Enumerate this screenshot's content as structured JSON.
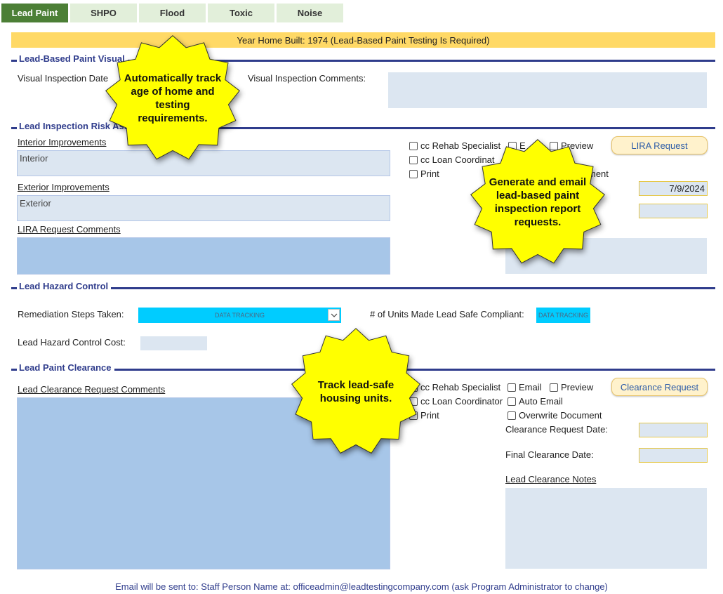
{
  "tabs": [
    {
      "label": "Lead Paint",
      "active": true
    },
    {
      "label": "SHPO",
      "active": false
    },
    {
      "label": "Flood",
      "active": false
    },
    {
      "label": "Toxic",
      "active": false
    },
    {
      "label": "Noise",
      "active": false
    }
  ],
  "banner": "Year Home Built: 1974 (Lead-Based Paint Testing Is Required)",
  "sections": {
    "visual": {
      "title": "Lead-Based Paint Visual",
      "date_label": "Visual Inspection Date",
      "comments_label": "Visual Inspection Comments:"
    },
    "lira": {
      "title": "Lead Inspection Risk Ass",
      "interior_label": "Interior Improvements",
      "interior_value": "Interior",
      "exterior_label": "Exterior Improvements",
      "exterior_value": "Exterior",
      "comments_label": "LIRA Request Comments",
      "cc_rehab": "cc Rehab Specialist",
      "cc_loan": "cc Loan Coordinat",
      "print": "Print",
      "email_partial": "E",
      "preview": "Preview",
      "overwrite_partial": "ment",
      "button": "LIRA Request",
      "date_value": "7/9/2024"
    },
    "hazard": {
      "title": "Lead Hazard Control",
      "remediation_label": "Remediation Steps Taken:",
      "remediation_value": "DATA TRACKING",
      "units_label": "# of Units Made Lead Safe Compliant:",
      "units_value": "DATA TRACKING",
      "cost_label": "Lead Hazard Control Cost:"
    },
    "clearance": {
      "title": "Lead Paint Clearance",
      "comments_label": "Lead Clearance Request Comments",
      "cc_rehab": "cc Rehab Specialist",
      "cc_loan": "cc Loan Coordinator",
      "print": "Print",
      "email": "Email",
      "auto_email": "Auto Email",
      "preview": "Preview",
      "overwrite": "Overwrite Document",
      "button": "Clearance Request",
      "request_date_label": "Clearance Request Date:",
      "final_date_label": "Final Clearance Date:",
      "notes_label": "Lead Clearance Notes"
    }
  },
  "callouts": {
    "age": "Automatically track age of home and testing requirements.",
    "email": "Generate and email  lead-based paint inspection report requests.",
    "track": "Track lead-safe housing units."
  },
  "footer": "Email will be sent to: Staff Person Name at: officeadmin@leadtestingcompany.com (ask Program Administrator to change)",
  "colors": {
    "active_tab": "#4c7f36",
    "tab": "#e2efda",
    "banner": "#ffd966",
    "section_rule": "#2f3c8c",
    "input_light": "#dce6f1",
    "input_mid": "#a7c6e8",
    "dropdown": "#00ccff",
    "callout": "#ffff00",
    "button_fill": "#fff2cc"
  }
}
